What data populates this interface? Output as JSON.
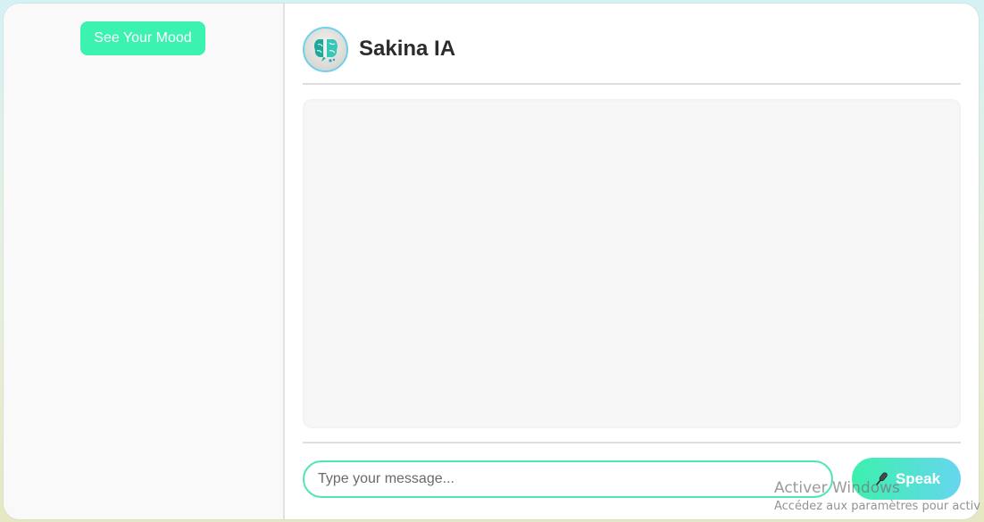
{
  "sidebar": {
    "mood_button_label": "See Your Mood"
  },
  "header": {
    "title": "Sakina IA",
    "avatar_icon": "brain-chat-icon"
  },
  "composer": {
    "placeholder": "Type your message...",
    "value": "",
    "speak_label": "Speak",
    "speak_icon": "microphone-icon"
  },
  "system_overlay": {
    "title": "Activer Windows",
    "subtitle": "Accédez aux paramètres pour activ"
  },
  "colors": {
    "accent_mint": "#3cf2b0",
    "accent_sky": "#66d6ee",
    "panel_bg": "#f9f9f9",
    "title_text": "#2c2c2c"
  }
}
